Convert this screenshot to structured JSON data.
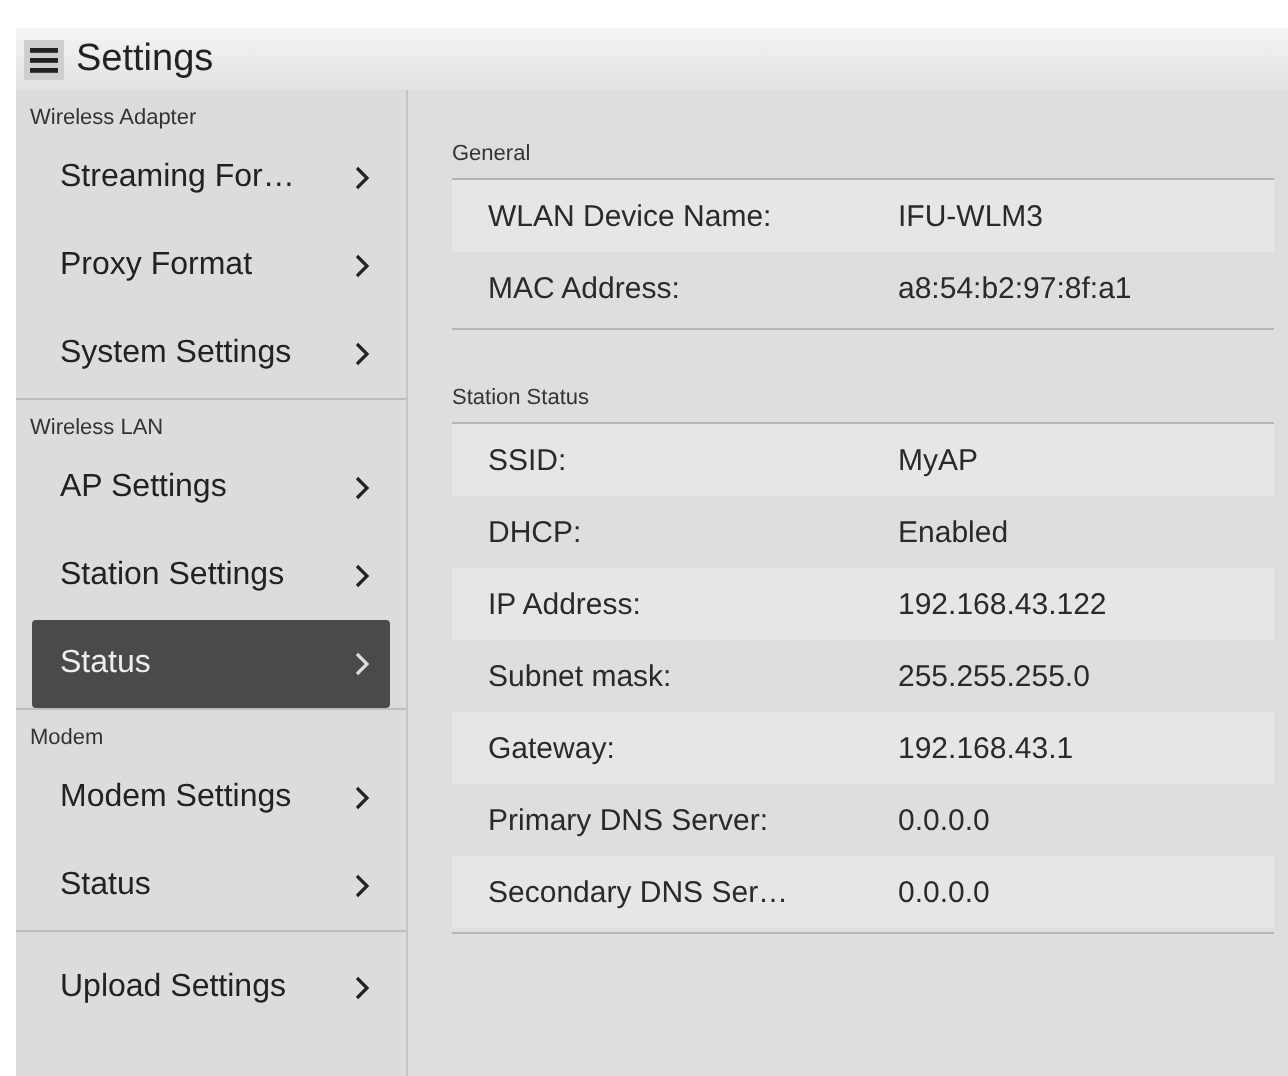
{
  "header": {
    "title": "Settings"
  },
  "sidebar": {
    "sections": [
      {
        "heading": "Wireless Adapter",
        "items": [
          {
            "label": "Streaming For…",
            "selected": false
          },
          {
            "label": "Proxy Format",
            "selected": false
          },
          {
            "label": "System Settings",
            "selected": false
          }
        ]
      },
      {
        "heading": "Wireless LAN",
        "items": [
          {
            "label": "AP Settings",
            "selected": false
          },
          {
            "label": "Station Settings",
            "selected": false
          },
          {
            "label": "Status",
            "selected": true
          }
        ]
      },
      {
        "heading": "Modem",
        "items": [
          {
            "label": "Modem Settings",
            "selected": false
          },
          {
            "label": "Status",
            "selected": false
          }
        ]
      },
      {
        "items": [
          {
            "label": "Upload Settings",
            "selected": false
          }
        ]
      }
    ]
  },
  "content": {
    "groups": [
      {
        "heading": "General",
        "rows": [
          {
            "label": "WLAN Device Name:",
            "value": "IFU-WLM3"
          },
          {
            "label": "MAC Address:",
            "value": "a8:54:b2:97:8f:a1"
          }
        ]
      },
      {
        "heading": "Station Status",
        "rows": [
          {
            "label": "SSID:",
            "value": "MyAP"
          },
          {
            "label": "DHCP:",
            "value": "Enabled"
          },
          {
            "label": "IP Address:",
            "value": "192.168.43.122"
          },
          {
            "label": "Subnet mask:",
            "value": "255.255.255.0"
          },
          {
            "label": "Gateway:",
            "value": "192.168.43.1"
          },
          {
            "label": "Primary DNS Server:",
            "value": "0.0.0.0"
          },
          {
            "label": "Secondary DNS Ser…",
            "value": "0.0.0.0"
          }
        ]
      }
    ]
  }
}
